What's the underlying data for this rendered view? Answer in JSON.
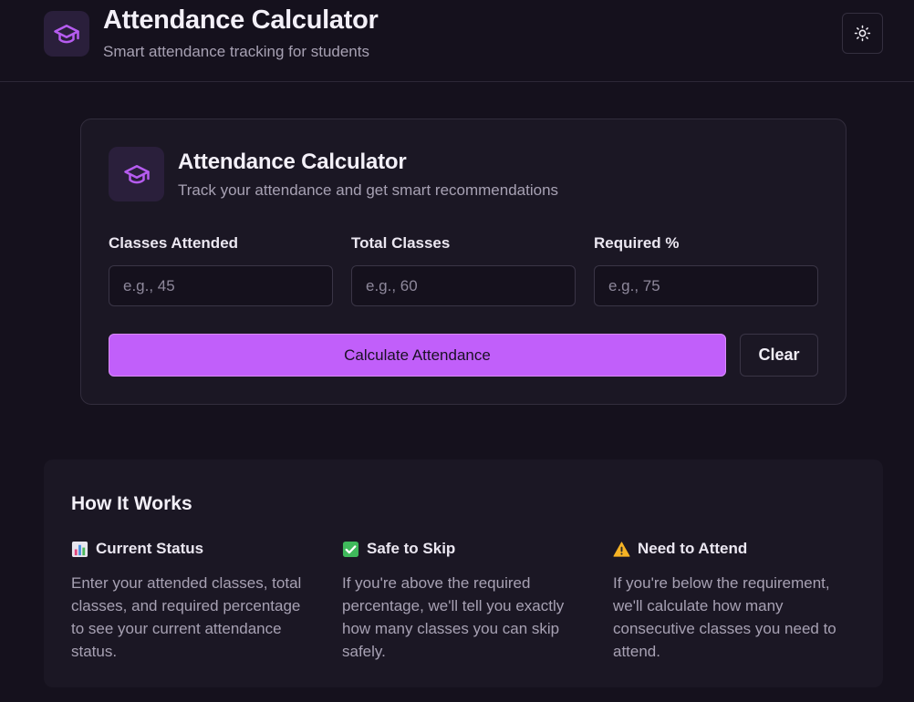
{
  "header": {
    "title": "Attendance Calculator",
    "subtitle": "Smart attendance tracking for students",
    "logo_icon": "graduation-cap-icon",
    "theme_toggle_icon": "sun-icon"
  },
  "calculator": {
    "title": "Attendance Calculator",
    "subtitle": "Track your attendance and get smart recommendations",
    "icon": "graduation-cap-icon",
    "fields": [
      {
        "label": "Classes Attended",
        "placeholder": "e.g., 45",
        "value": ""
      },
      {
        "label": "Total Classes",
        "placeholder": "e.g., 60",
        "value": ""
      },
      {
        "label": "Required %",
        "placeholder": "e.g., 75",
        "value": ""
      }
    ],
    "calculate_label": "Calculate Attendance",
    "clear_label": "Clear"
  },
  "how_it_works": {
    "title": "How It Works",
    "items": [
      {
        "icon": "bar-chart-icon",
        "title": "Current Status",
        "text": "Enter your attended classes, total classes, and required percentage to see your current attendance status."
      },
      {
        "icon": "check-mark-icon",
        "title": "Safe to Skip",
        "text": "If you're above the required percentage, we'll tell you exactly how many classes you can skip safely."
      },
      {
        "icon": "warning-icon",
        "title": "Need to Attend",
        "text": "If you're below the requirement, we'll calculate how many consecutive classes you need to attend."
      }
    ]
  },
  "colors": {
    "background": "#15111d",
    "card": "#1b1724",
    "accent": "#c15ffa",
    "icon_tint": "#b65cf0"
  }
}
